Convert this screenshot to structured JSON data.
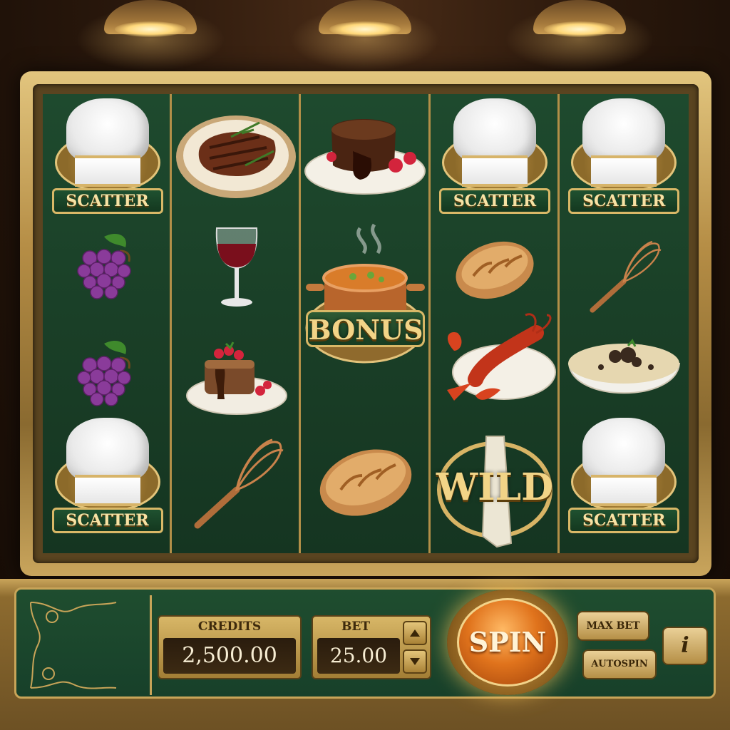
{
  "symbols": {
    "scatter": "SCATTER",
    "bonus": "BONUS",
    "wild": "WILD"
  },
  "panel": {
    "credits_label": "CREDITS",
    "credits_value": "2,500.00",
    "bet_label": "BET",
    "bet_value": "25.00",
    "spin_label": "SPIN",
    "max_bet_label": "MAX BET",
    "autospin_label": "AUTOSPIN",
    "info_label": "i"
  },
  "reels": [
    [
      "scatter",
      "grapes",
      "grapes",
      "scatter"
    ],
    [
      "steak",
      "wine",
      "chocolate-cake",
      "whisk"
    ],
    [
      "lava-cake",
      "bonus-soup-pot",
      "bread",
      "bread-empty"
    ],
    [
      "scatter",
      "bread",
      "lobster",
      "wild"
    ],
    [
      "scatter",
      "whisk",
      "risotto",
      "scatter"
    ]
  ],
  "colors": {
    "felt": "#1a3f27",
    "gold": "#c8a458",
    "spin": "#e0731c"
  }
}
